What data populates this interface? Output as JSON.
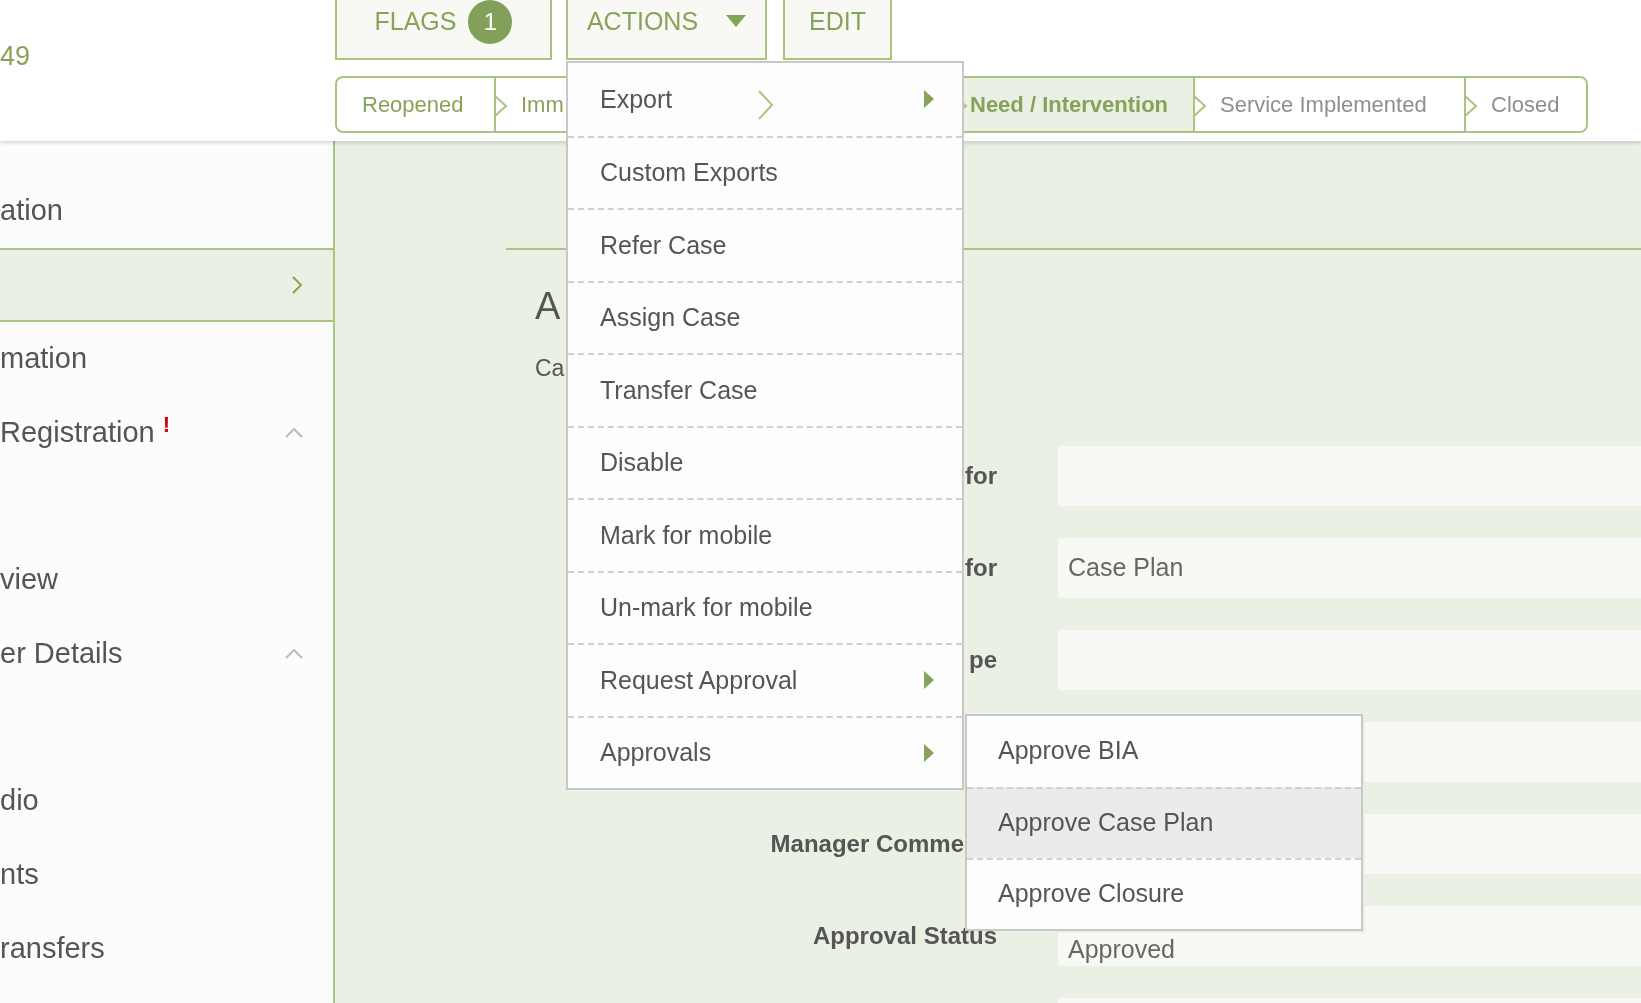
{
  "header": {
    "case_id": "49",
    "buttons": [
      {
        "label": "FLAGS",
        "badge": "1",
        "caret": false
      },
      {
        "label": "ACTIONS",
        "caret": true
      },
      {
        "label": "EDIT",
        "caret": false
      }
    ]
  },
  "progress": [
    {
      "label": "Reopened",
      "completed": true,
      "selected": false
    },
    {
      "label": "Imm",
      "completed": true,
      "selected": false
    },
    {
      "label": "Need / Intervention",
      "completed": true,
      "selected": true
    },
    {
      "label": "Service Implemented",
      "completed": false,
      "selected": false
    },
    {
      "label": "Closed",
      "completed": false,
      "selected": false
    }
  ],
  "sidebar": {
    "items": [
      {
        "label": "ation",
        "selected": false,
        "expanded": false
      },
      {
        "selected": true,
        "expanded": false
      },
      {
        "label": "mation",
        "selected": false,
        "expanded": false
      },
      {
        "label": "Registration",
        "flag": "!",
        "selected": false,
        "expanded": true
      },
      {
        "label": "view",
        "selected": false,
        "expanded": false
      },
      {
        "label": "er Details",
        "selected": false,
        "expanded": true
      },
      {
        "label": "dio",
        "selected": false,
        "expanded": false
      },
      {
        "label": "nts",
        "selected": false,
        "expanded": false
      },
      {
        "label": "ransfers",
        "selected": false,
        "expanded": false
      }
    ]
  },
  "main": {
    "title": "A",
    "subtitle": "Ca",
    "fields": [
      {
        "kind": "text",
        "label": "for"
      },
      {
        "kind": "text",
        "label": "for",
        "value": "Case Plan"
      },
      {
        "kind": "text",
        "label": "pe"
      },
      {
        "kind": "text"
      },
      {
        "kind": "text",
        "label": "Manager Comme",
        "under_menu": true
      },
      {
        "kind": "text",
        "label": "Approval Status",
        "value": "Approved",
        "under_menu": true
      },
      {
        "kind": "text"
      }
    ]
  },
  "actions_menu": {
    "open": true,
    "items": [
      {
        "label": "Export",
        "submenu": true
      },
      {
        "label": "Custom Exports",
        "submenu": false
      },
      {
        "label": "Refer Case",
        "submenu": false
      },
      {
        "label": "Assign Case",
        "submenu": false
      },
      {
        "label": "Transfer Case",
        "submenu": false
      },
      {
        "label": "Disable",
        "submenu": false
      },
      {
        "label": "Mark for mobile",
        "submenu": false
      },
      {
        "label": "Un-mark for mobile",
        "submenu": false
      },
      {
        "label": "Request Approval",
        "submenu": true
      },
      {
        "label": "Approvals",
        "submenu": true,
        "children": [
          {
            "label": "Approve BIA",
            "selected": false
          },
          {
            "label": "Approve Case Plan",
            "selected": true
          },
          {
            "label": "Approve Closure",
            "selected": false
          }
        ]
      }
    ]
  }
}
